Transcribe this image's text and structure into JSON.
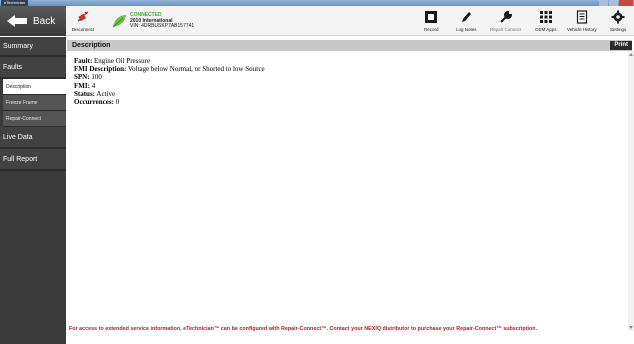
{
  "window": {
    "app_tag": "eTechnician"
  },
  "toolbar": {
    "back_label": "Back",
    "disconnect_label": "Disconnect",
    "connection": {
      "status": "CONNECTED",
      "vehicle": "2010 International",
      "vin": "VIN: 4DRBUSKP7AB157741"
    },
    "items": [
      {
        "label": "Record",
        "icon": "record-icon"
      },
      {
        "label": "Log Notes",
        "icon": "pencil-icon"
      },
      {
        "label": "Repair Connect",
        "icon": "wrench-icon"
      },
      {
        "label": "OEM Apps",
        "icon": "grid-icon"
      },
      {
        "label": "Vehicle History",
        "icon": "document-icon"
      },
      {
        "label": "Settings",
        "icon": "gear-icon"
      }
    ]
  },
  "sidebar": {
    "summary": "Summary",
    "faults": "Faults",
    "sub_items": [
      "Description",
      "Freeze Frame",
      "Repair-Connect"
    ],
    "active_sub": "Description",
    "live_data": "Live Data",
    "full_report": "Full Report"
  },
  "main": {
    "header_title": "Description",
    "print_label": "Print",
    "fault": {
      "label": "Fault:",
      "value": "Engine Oil Pressure"
    },
    "fmi_description": {
      "label": "FMI Description:",
      "value": "Voltage below Normal, or Shorted to low Source"
    },
    "spn": {
      "label": "SPN:",
      "value": "100"
    },
    "fmi": {
      "label": "FMI:",
      "value": "4"
    },
    "status": {
      "label": "Status:",
      "value": "Active"
    },
    "occurrences": {
      "label": "Occurrences:",
      "value": "0"
    },
    "footer_text": "For access to extended service information, eTechnician™ can be configured with Repair-Connect™. Contact your NEXIQ distributor to purchase your Repair-Connect™ subscription."
  },
  "colors": {
    "connected_green": "#4aa636",
    "sidebar_bg": "#3a3a3a",
    "header_gray": "#c8c8c8",
    "footer_red": "#b3201f"
  }
}
